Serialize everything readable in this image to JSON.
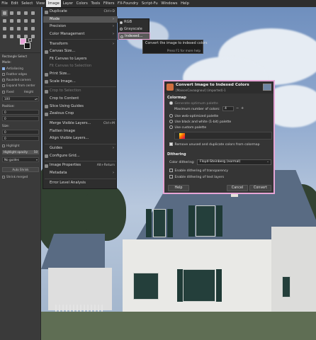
{
  "menubar": {
    "items": [
      "File",
      "Edit",
      "Select",
      "View",
      "Image",
      "Layer",
      "Colors",
      "Tools",
      "Filters",
      "FX-Foundry",
      "Script-Fu",
      "Windows",
      "Help"
    ],
    "active_index": 4
  },
  "toolbox": {
    "tool_options_title": "Rectangle Select",
    "mode_label": "Mode:",
    "antialiasing": "Antialiasing",
    "feather_edges": "Feather edges",
    "rounded_corners": "Rounded corners",
    "expand_from_center": "Expand from center",
    "fixed_label": "Fixed",
    "fixed_value": "Height",
    "size_value": "100",
    "position_label": "Position:",
    "position_x": "0",
    "position_y": "0",
    "size_label": "Size:",
    "size_w": "0",
    "size_h": "0",
    "highlight_label": "Highlight",
    "highlight_opacity_label": "Highlight opacity",
    "highlight_opacity_value": "50",
    "guides_label": "No guides",
    "auto_shrink_label": "Auto Shrink",
    "shrink_merged_label": "Shrink merged",
    "fg_color": "#e9a3d8",
    "bg_color": "#111111"
  },
  "image_menu": {
    "items": [
      {
        "label": "Duplicate",
        "shortcut": "Ctrl+D",
        "state": "normal",
        "submenu": false,
        "icon": "duplicate-icon"
      },
      {
        "label": "Mode",
        "shortcut": "",
        "state": "highlighted",
        "submenu": true,
        "icon": ""
      },
      {
        "label": "Precision",
        "shortcut": "",
        "state": "normal",
        "submenu": true,
        "icon": ""
      },
      {
        "label": "Color Management",
        "shortcut": "",
        "state": "normal",
        "submenu": true,
        "icon": ""
      },
      {
        "label": "Transform",
        "shortcut": "",
        "state": "normal",
        "submenu": true,
        "icon": ""
      },
      {
        "label": "Canvas Size...",
        "shortcut": "",
        "state": "normal",
        "submenu": false,
        "icon": "canvas-size-icon"
      },
      {
        "label": "Fit Canvas to Layers",
        "shortcut": "",
        "state": "normal",
        "submenu": false,
        "icon": ""
      },
      {
        "label": "Fit Canvas to Selection",
        "shortcut": "",
        "state": "disabled",
        "submenu": false,
        "icon": ""
      },
      {
        "label": "Print Size...",
        "shortcut": "",
        "state": "normal",
        "submenu": false,
        "icon": "print-size-icon"
      },
      {
        "label": "Scale Image...",
        "shortcut": "",
        "state": "normal",
        "submenu": false,
        "icon": "scale-image-icon"
      },
      {
        "label": "Crop to Selection",
        "shortcut": "",
        "state": "disabled",
        "submenu": false,
        "icon": "crop-icon"
      },
      {
        "label": "Crop to Content",
        "shortcut": "",
        "state": "normal",
        "submenu": false,
        "icon": ""
      },
      {
        "label": "Slice Using Guides",
        "shortcut": "",
        "state": "normal",
        "submenu": false,
        "icon": "slice-icon"
      },
      {
        "label": "Zealous Crop",
        "shortcut": "",
        "state": "normal",
        "submenu": false,
        "icon": "zealous-crop-icon"
      },
      {
        "label": "Merge Visible Layers...",
        "shortcut": "Ctrl+M",
        "state": "normal",
        "submenu": false,
        "icon": ""
      },
      {
        "label": "Flatten Image",
        "shortcut": "",
        "state": "normal",
        "submenu": false,
        "icon": ""
      },
      {
        "label": "Align Visible Layers...",
        "shortcut": "",
        "state": "normal",
        "submenu": false,
        "icon": ""
      },
      {
        "label": "Guides",
        "shortcut": "",
        "state": "normal",
        "submenu": true,
        "icon": ""
      },
      {
        "label": "Configure Grid...",
        "shortcut": "",
        "state": "normal",
        "submenu": false,
        "icon": "grid-icon"
      },
      {
        "label": "Image Properties",
        "shortcut": "Alt+Return",
        "state": "normal",
        "submenu": false,
        "icon": "info-icon"
      },
      {
        "label": "Metadata",
        "shortcut": "",
        "state": "normal",
        "submenu": true,
        "icon": ""
      },
      {
        "label": "Error Level Analysis",
        "shortcut": "",
        "state": "normal",
        "submenu": false,
        "icon": ""
      }
    ]
  },
  "mode_menu": {
    "items": [
      {
        "label": "RGB",
        "checked": true,
        "highlighted": false
      },
      {
        "label": "Grayscale",
        "checked": false,
        "highlighted": false
      },
      {
        "label": "Indexed...",
        "checked": false,
        "highlighted": true
      }
    ]
  },
  "tooltip": {
    "text": "Convert the image to indexed colors",
    "hint": "Press F1 for more help"
  },
  "dialog": {
    "title": "Convert Image to Indexed Colors",
    "subtitle": "[MaisonCavaagnoul] (imported)-1",
    "colormap_heading": "Colormap",
    "opt_generate": "Generate optimum palette",
    "max_colors_label": "Maximum number of colors:",
    "max_colors_value": "4",
    "opt_web": "Use web-optimized palette",
    "opt_bw": "Use black and white (1-bit) palette",
    "opt_custom": "Use custom palette",
    "remove_unused": "Remove unused and duplicate colors from colormap",
    "dithering_heading": "Dithering",
    "color_dithering_label": "Color dithering:",
    "color_dithering_value": "Floyd-Steinberg (normal)",
    "dither_transparency": "Enable dithering of transparency",
    "dither_text": "Enable dithering of text layers",
    "help_button": "Help",
    "cancel_button": "Cancel",
    "convert_button": "Convert",
    "accent_color": "#e7a5d6"
  }
}
